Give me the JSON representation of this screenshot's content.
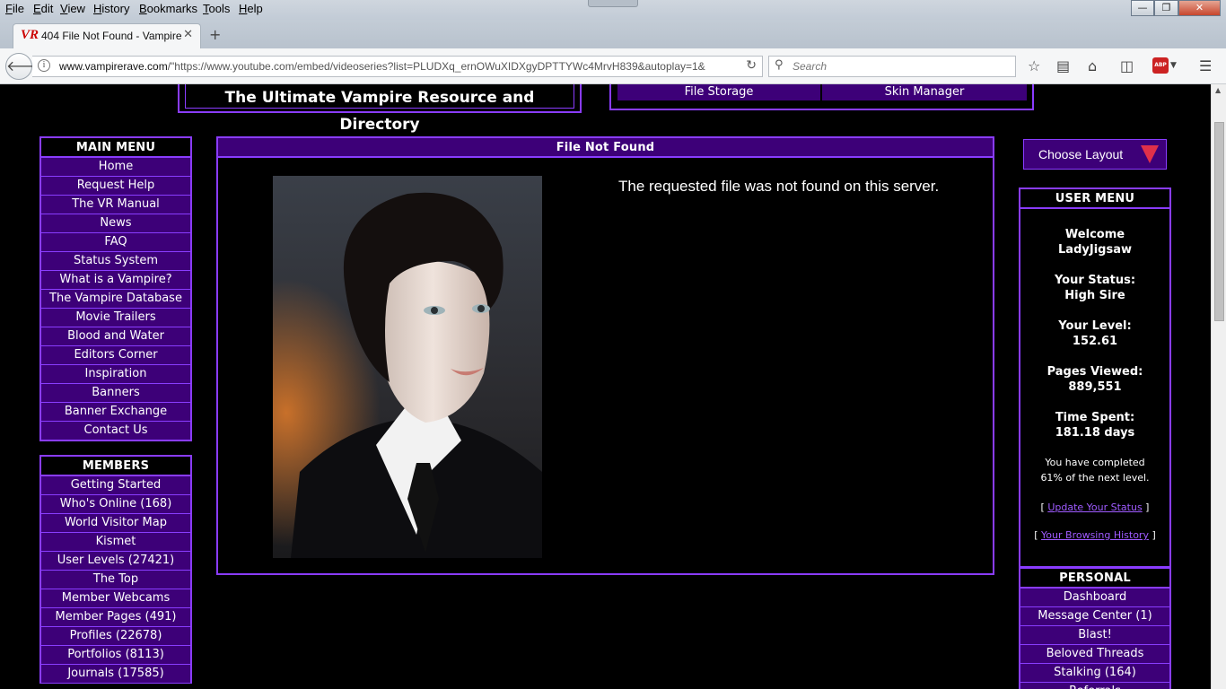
{
  "browser": {
    "menu": [
      "File",
      "Edit",
      "View",
      "History",
      "Bookmarks",
      "Tools",
      "Help"
    ],
    "tab_favicon": "VR",
    "tab_title": "404 File Not Found - Vampire",
    "new_tab": "+",
    "url_domain": "www.vampirerave.com",
    "url_rest": "/\"https://www.youtube.com/embed/videoseries?list=PLUDXq_ernOWuXIDXgyDPTTYWc4MrvH839&autoplay=1&",
    "search_placeholder": "Search",
    "window_buttons": [
      "—",
      "❐",
      "✕"
    ],
    "toolbar_icons": [
      "star-icon",
      "reading-list-icon",
      "home-icon",
      "pocket-icon",
      "adblock-icon",
      "menu-icon"
    ]
  },
  "site": {
    "banner_title": "The Ultimate Vampire Resource and Directory",
    "top_nav": [
      "File Storage",
      "Skin Manager"
    ]
  },
  "main_menu": {
    "title": "MAIN MENU",
    "items": [
      "Home",
      "Request Help",
      "The VR Manual",
      "News",
      "FAQ",
      "Status System",
      "What is a Vampire?",
      "The Vampire Database",
      "Movie Trailers",
      "Blood and Water",
      "Editors Corner",
      "Inspiration",
      "Banners",
      "Banner Exchange",
      "Contact Us"
    ]
  },
  "members_menu": {
    "title": "MEMBERS",
    "items": [
      "Getting Started",
      "Who's Online (168)",
      "World Visitor Map",
      "Kismet",
      "User Levels (27421)",
      "The Top",
      "Member Webcams",
      "Member Pages (491)",
      "Profiles (22678)",
      "Portfolios (8113)",
      "Journals (17585)"
    ]
  },
  "main": {
    "title": "File Not Found",
    "message": "The requested file was not found on this server."
  },
  "layout_button": "Choose Layout",
  "user_menu": {
    "title": "USER MENU",
    "welcome_label": "Welcome",
    "username": "LadyJigsaw",
    "status_label": "Your Status:",
    "status_value": "High Sire",
    "level_label": "Your Level:",
    "level_value": "152.61",
    "pages_label": "Pages Viewed:",
    "pages_value": "889,551",
    "time_label": "Time Spent:",
    "time_value": "181.18 days",
    "progress_line1": "You have completed",
    "progress_line2": "61% of the next level.",
    "update_link": "Update Your Status",
    "history_link": "Your Browsing History"
  },
  "personal": {
    "title": "PERSONAL",
    "items": [
      "Dashboard",
      "Message Center (1)",
      "Blast!",
      "Beloved Threads",
      "Stalking (164)",
      "Referrals"
    ]
  },
  "colors": {
    "accent_purple": "#8a3cff",
    "nav_fill": "#3d0078",
    "background": "#000000",
    "layout_arrow": "#e0304a"
  }
}
